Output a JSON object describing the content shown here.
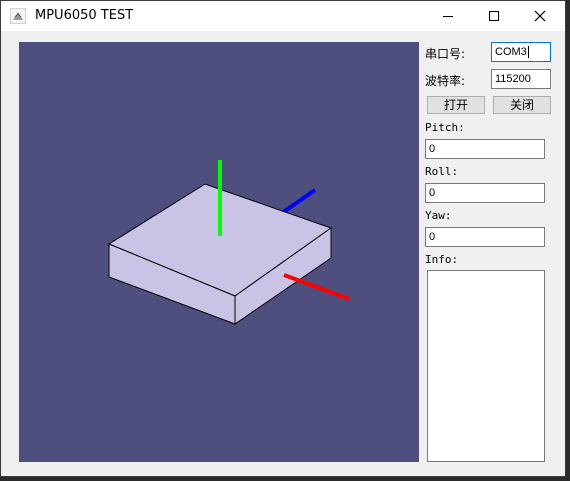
{
  "window": {
    "title": "MPU6050 TEST",
    "controls": {
      "minimize": "minimize-icon",
      "maximize": "maximize-icon",
      "close": "close-icon"
    }
  },
  "serial": {
    "port_label": "串口号:",
    "port_value": "COM3",
    "baud_label": "波特率:",
    "baud_value": "115200",
    "open_button": "打开",
    "close_button": "关闭"
  },
  "readouts": {
    "pitch_label": "Pitch:",
    "pitch_value": "0",
    "roll_label": "Roll:",
    "roll_value": "0",
    "yaw_label": "Yaw:",
    "yaw_value": "0",
    "info_label": "Info:",
    "info_value": ""
  },
  "viewport": {
    "background": "#4f4f7f",
    "box_color": "#c9c4e6",
    "axis_colors": {
      "x": "#ff0000",
      "y": "#00ff00",
      "z": "#0000ff"
    }
  }
}
